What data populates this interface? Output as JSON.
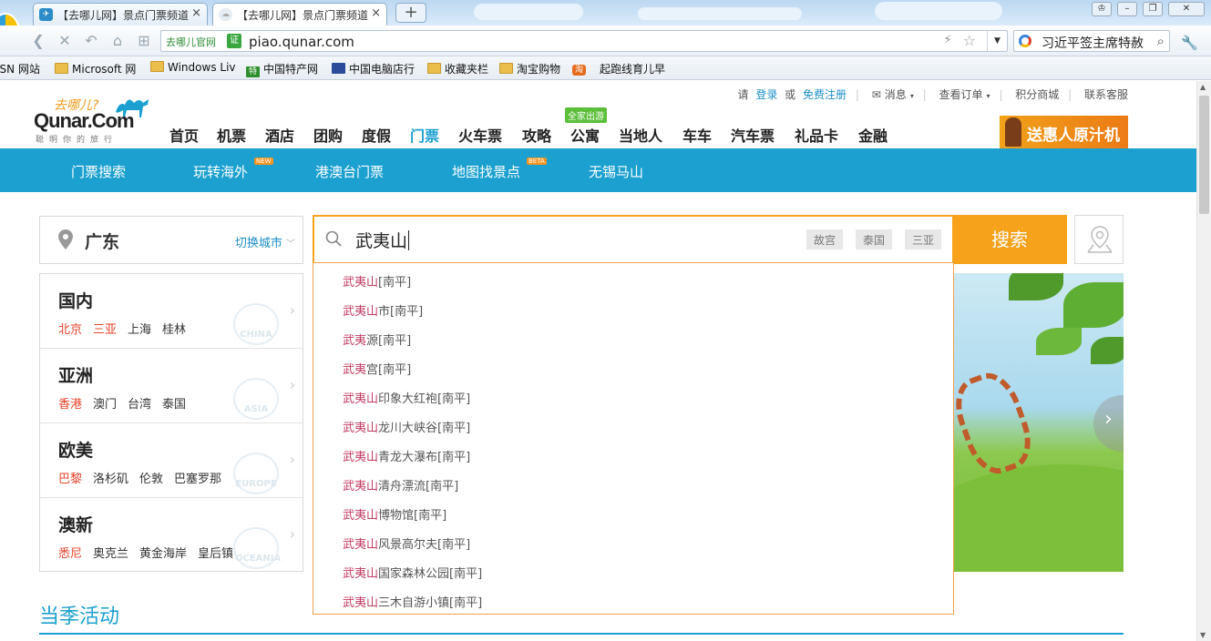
{
  "browser": {
    "tabs": [
      {
        "title": "【去哪儿网】景点门票频道",
        "favicon": "qunar-favicon"
      },
      {
        "title": "【去哪儿网】景点门票频道",
        "favicon": "cloud-favicon"
      }
    ],
    "tab_close_glyph": "×",
    "new_tab_glyph": "+",
    "address": {
      "site_tag": "去哪儿官网",
      "verify_badge": "证",
      "url": "piao.qunar.com"
    },
    "search": {
      "query": "习近平签主席特赦"
    },
    "bookmarks": [
      "ISN 网站",
      "Microsoft 网",
      "Windows Liv",
      "中国特产网",
      "中国电脑店行",
      "收藏夹栏",
      "淘宝购物",
      "起跑线育儿早"
    ],
    "bookmark_icon_labels": [
      "特",
      "淘"
    ]
  },
  "header": {
    "login_prompt": "请",
    "login": "登录",
    "or": "或",
    "register": "免费注册",
    "messages": "消息",
    "orders": "查看订单",
    "points": "积分商城",
    "support": "联系客服",
    "logo": {
      "cn": "去哪儿?",
      "en": "Qunar.Com",
      "tagline": "聪明你的旅行"
    },
    "nav": [
      "首页",
      "机票",
      "酒店",
      "团购",
      "度假",
      "门票",
      "火车票",
      "攻略",
      "公寓",
      "当地人",
      "车车",
      "汽车票",
      "礼品卡",
      "金融"
    ],
    "current_nav": "门票",
    "nav_badge": "全家出游",
    "ad_text": "送惠人原汁机"
  },
  "subnav": {
    "items": [
      "门票搜索",
      "玩转海外",
      "港澳台门票",
      "地图找景点",
      "无锡马山"
    ],
    "badges": {
      "new": "NEW",
      "beta": "BETA"
    }
  },
  "city": {
    "name": "广东",
    "switch_label": "切换城市"
  },
  "regions": [
    {
      "title": "国内",
      "cities": [
        "北京",
        "三亚",
        "上海",
        "桂林"
      ],
      "hot": [
        0,
        1
      ],
      "stamp": "CHINA"
    },
    {
      "title": "亚洲",
      "cities": [
        "香港",
        "澳门",
        "台湾",
        "泰国"
      ],
      "hot": [
        0
      ],
      "stamp": "ASIA"
    },
    {
      "title": "欧美",
      "cities": [
        "巴黎",
        "洛杉矶",
        "伦敦",
        "巴塞罗那"
      ],
      "hot": [
        0
      ],
      "stamp": "EUROPE"
    },
    {
      "title": "澳新",
      "cities": [
        "悉尼",
        "奥克兰",
        "黄金海岸",
        "皇后镇"
      ],
      "hot": [
        0
      ],
      "stamp": "OCEANIA"
    }
  ],
  "search": {
    "query": "武夷山",
    "chips": [
      "故宫",
      "泰国",
      "三亚"
    ],
    "button": "搜索"
  },
  "suggestions": [
    {
      "hl": "武夷山",
      "rest": "[南平]"
    },
    {
      "hl": "武夷山",
      "rest": "市[南平]"
    },
    {
      "hl": "武夷",
      "rest": "源[南平]"
    },
    {
      "hl": "武夷",
      "rest": "宫[南平]"
    },
    {
      "hl": "武夷山",
      "rest": "印象大红袍[南平]"
    },
    {
      "hl": "武夷山",
      "rest": "龙川大峡谷[南平]"
    },
    {
      "hl": "武夷山",
      "rest": "青龙大瀑布[南平]"
    },
    {
      "hl": "武夷山",
      "rest": "清舟漂流[南平]"
    },
    {
      "hl": "武夷山",
      "rest": "博物馆[南平]"
    },
    {
      "hl": "武夷山",
      "rest": "风景高尔夫[南平]"
    },
    {
      "hl": "武夷山",
      "rest": "国家森林公园[南平]"
    },
    {
      "hl": "武夷山",
      "rest": "三木自游小镇[南平]"
    }
  ],
  "section": {
    "title": "当季活动"
  },
  "colors": {
    "accent": "#1ba0cf",
    "orange": "#f7a21b",
    "hot_city": "#e8432a",
    "highlight": "#c03a62"
  }
}
